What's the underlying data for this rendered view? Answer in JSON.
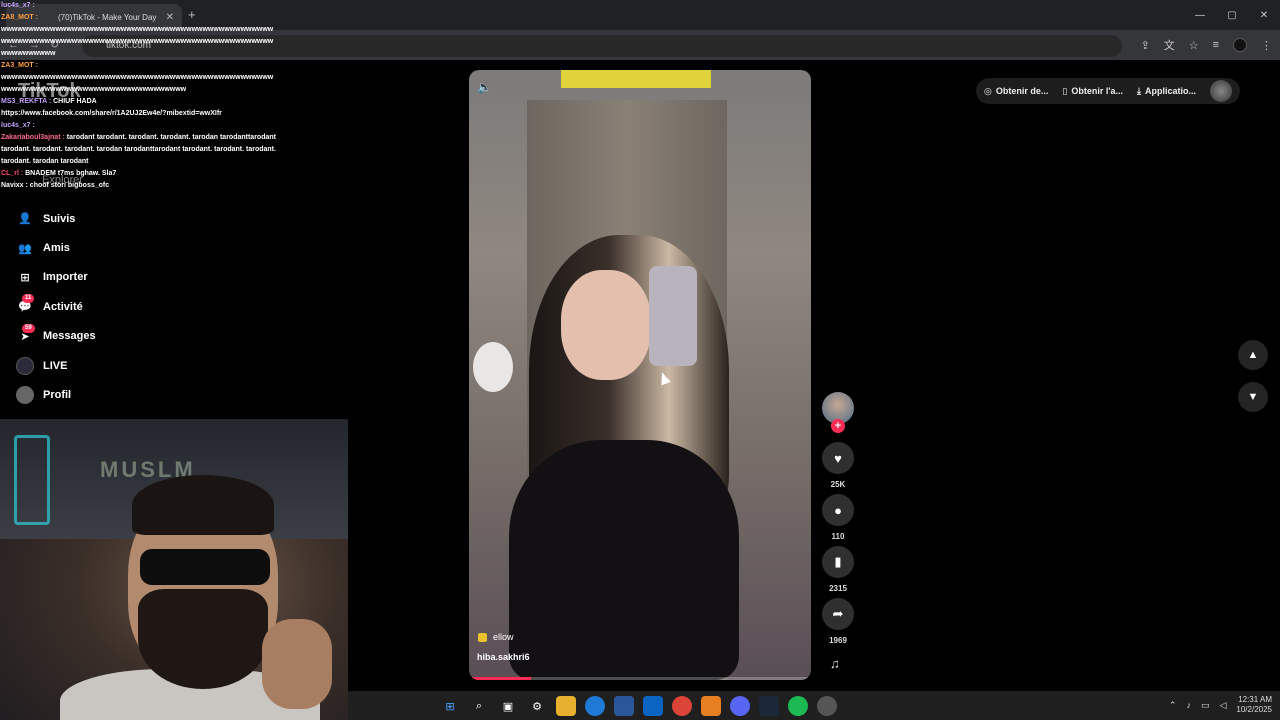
{
  "browser": {
    "tab_title": "(70)TikTok - Make Your Day",
    "tab_close": "✕",
    "new_tab": "+",
    "url": "tiktok.com",
    "window_controls": [
      "—",
      "▢",
      "✕"
    ]
  },
  "chat": [
    {
      "user": "luc4s_x7 :",
      "user_color": "#c7a2ff",
      "text": ""
    },
    {
      "user": "ZA8_MOT :",
      "user_color": "#ff9f43",
      "text": ""
    },
    {
      "user": "",
      "user_color": "#fff",
      "text": "wwwwwwwwwwwwwwwwwwwwwwwwwwwwwwwwwwwwwwwwwwwwwwwwwwwwwwwwwwwwwwwwwwwwwwwwwwwwwwwwwwwwwwwwwwwwwwwwwwwwwwwwwwwwww"
    },
    {
      "user": "ZA3_MOT :",
      "user_color": "#ff9f43",
      "text": ""
    },
    {
      "user": "",
      "user_color": "#fff",
      "text": "wwwwwwwwwwwwwwwwwwwwwwwwwwwwwwwwwwwwwwwwwwwwwwwwwwwwwwwwwwwwwwwwwwwwwwwwwwwwwwwwwwww"
    },
    {
      "user": "MS3_REKFTA :",
      "user_color": "#c7a2ff",
      "text": "CHIUF HADA"
    },
    {
      "user": "",
      "user_color": "#fff",
      "text": "https://www.facebook.com/share/r/1A2UJ2Ew4e/?mibextid=wwXIfr"
    },
    {
      "user": "luc4s_x7 :",
      "user_color": "#c7a2ff",
      "text": ""
    },
    {
      "user": "Zakariaboul3ajnat :",
      "user_color": "#ff6b8b",
      "text": "tarodant tarodant. tarodant. tarodant. tarodan tarodanttarodant tarodant. tarodant. tarodant. tarodan tarodanttarodant tarodant. tarodant. tarodant. tarodant. tarodan tarodant"
    },
    {
      "user": "CL_rl :",
      "user_color": "#ff4d6d",
      "text": "BNADEM t7ms bghaw. Sla7"
    },
    {
      "user": "Navixx :",
      "user_color": "#fff",
      "text": "choof stori bigboss_ofc"
    }
  ],
  "logo": "TikTok",
  "sidebar": {
    "explorer": "Explorer",
    "items": [
      {
        "label": "Suivis",
        "icon": "👤"
      },
      {
        "label": "Amis",
        "icon": "👥"
      },
      {
        "label": "Importer",
        "icon": "⊞"
      },
      {
        "label": "Activité",
        "icon": "💬",
        "badge": "11"
      },
      {
        "label": "Messages",
        "icon": "➤",
        "badge": "59"
      },
      {
        "label": "LIVE",
        "icon": ""
      },
      {
        "label": "Profil",
        "icon": ""
      }
    ]
  },
  "webcam": {
    "sign": "MUSLM"
  },
  "video": {
    "volume_icon": "🔈",
    "music": "ellow",
    "author": "hiba.sakhri6",
    "progress": 0.18
  },
  "actions": {
    "likes": "25K",
    "comments": "110",
    "saves": "2315",
    "shares": "1969"
  },
  "topright": {
    "btn1": "Obtenir de...",
    "btn2": "Obtenir l'a...",
    "btn3": "Applicatio..."
  },
  "taskbar": {
    "time": "12:31 AM",
    "date": "10/2/2025"
  }
}
